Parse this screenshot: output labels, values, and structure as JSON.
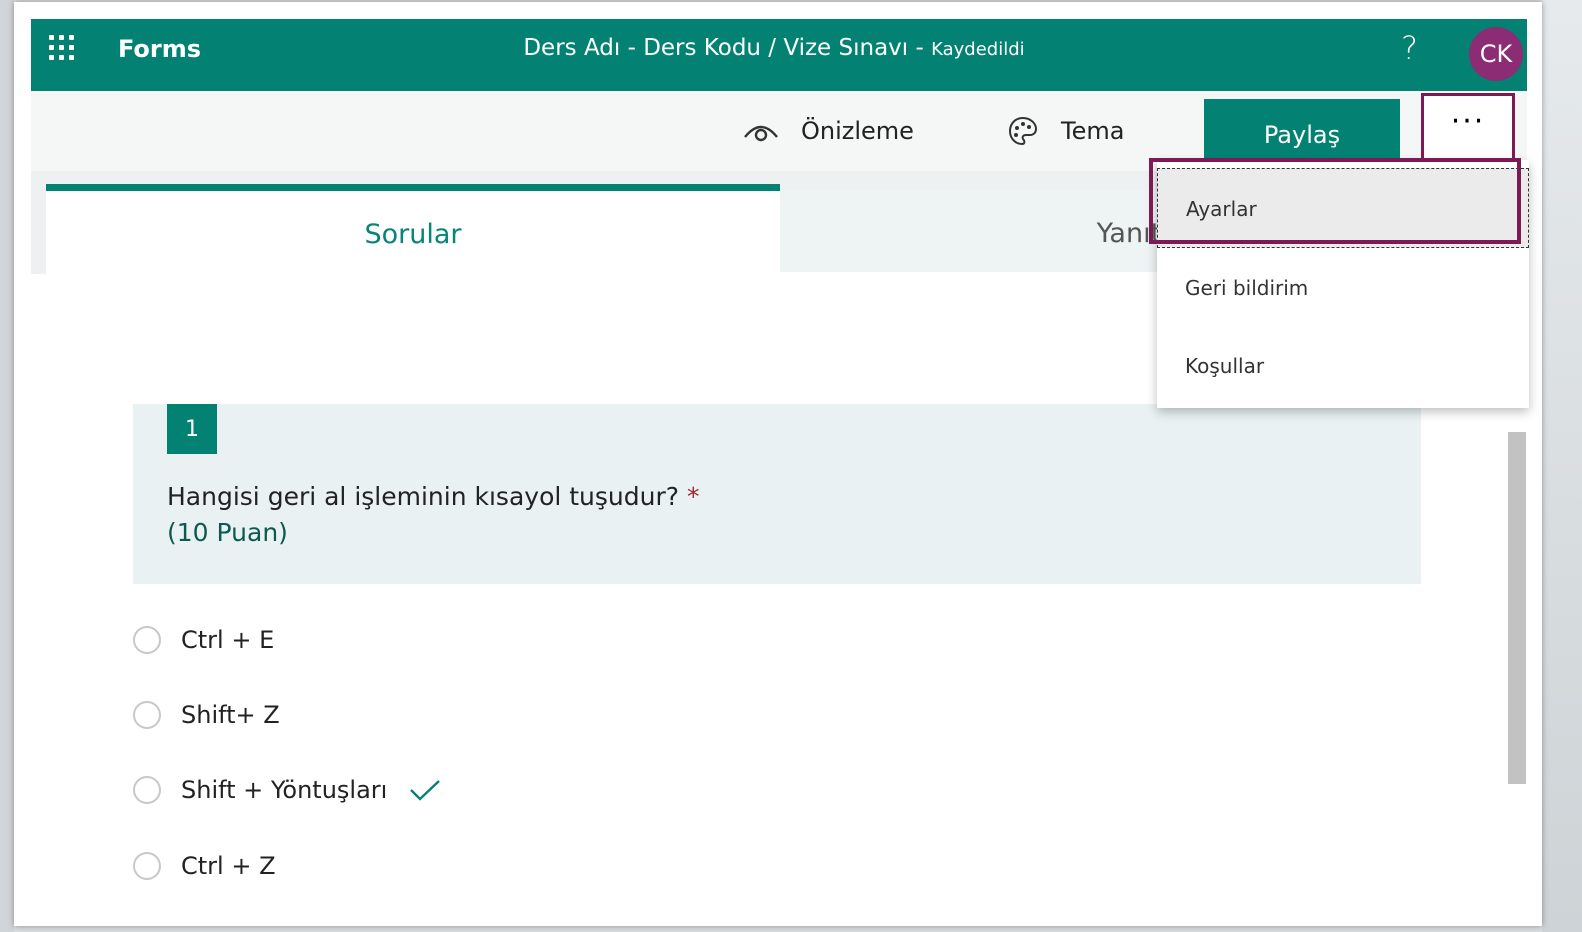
{
  "header": {
    "app_name": "Forms",
    "form_title": "Ders Adı - Ders Kodu / Vize Sınavı",
    "separator": " - ",
    "save_status": "Kaydedildi",
    "help": "?",
    "avatar_initials": "CK"
  },
  "toolbar": {
    "preview_label": "Önizleme",
    "theme_label": "Tema",
    "share_label": "Paylaş",
    "more_label": "···"
  },
  "tabs": {
    "questions": "Sorular",
    "responses": "Yanıtlar"
  },
  "menu": {
    "items": [
      "Ayarlar",
      "Geri bildirim",
      "Koşullar"
    ]
  },
  "question": {
    "number": "1",
    "text": "Hangisi geri al işleminin kısayol tuşudur?",
    "required_mark": " *",
    "points": "(10 Puan)",
    "options": [
      "Ctrl + E",
      "Shift+ Z",
      "Shift + Yöntuşları",
      "Ctrl + Z"
    ]
  },
  "colors": {
    "brand": "#038273",
    "highlight": "#7d1a55",
    "avatar": "#8b2c74"
  }
}
